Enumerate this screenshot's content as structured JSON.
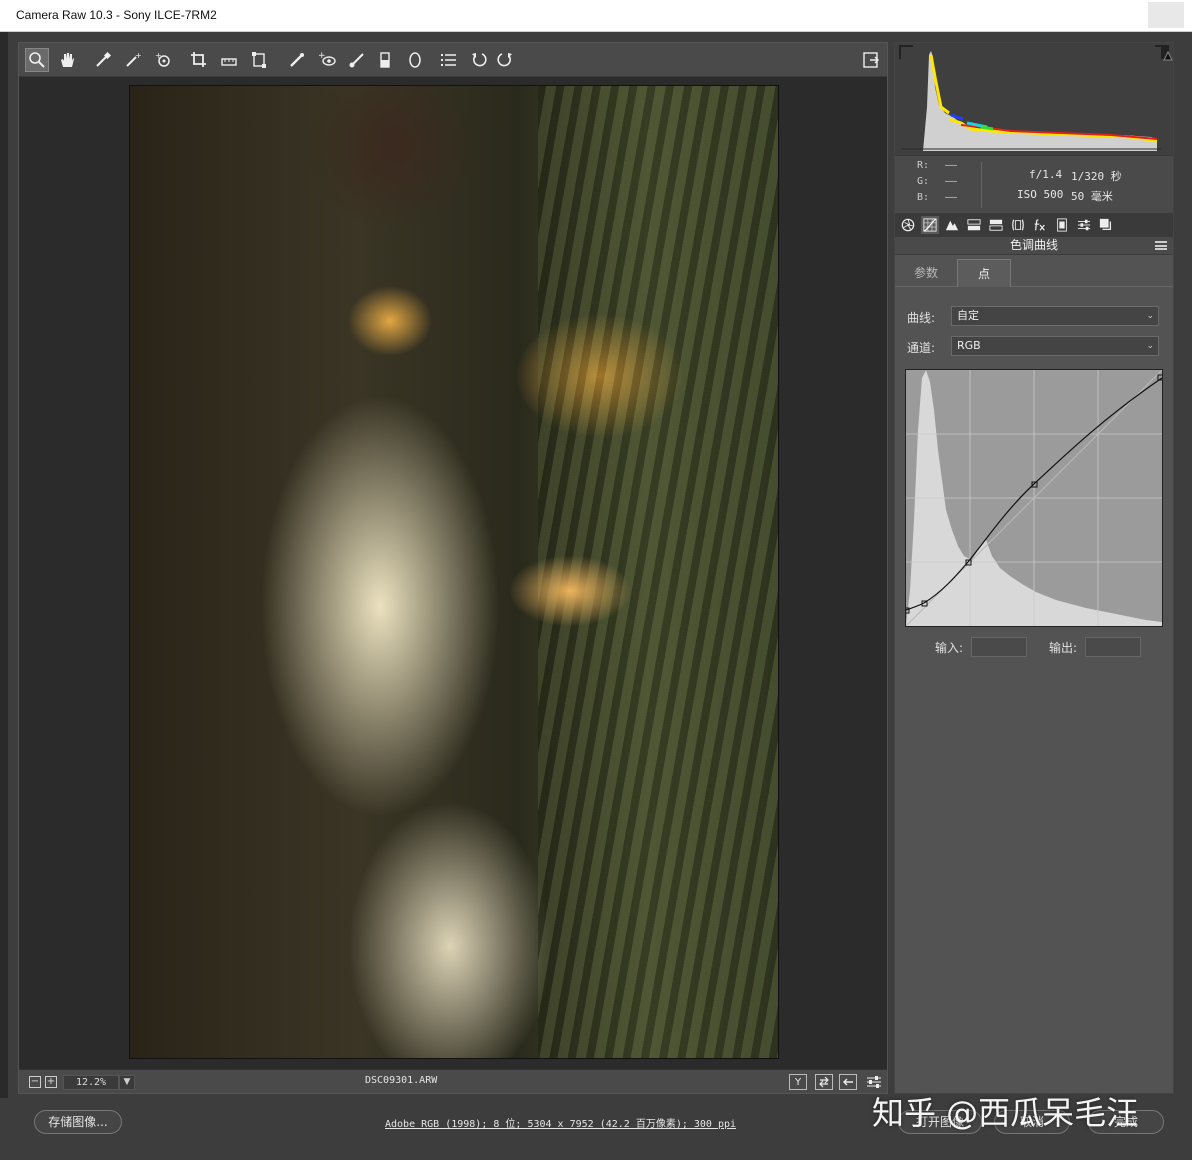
{
  "window": {
    "title": "Camera Raw 10.3 -  Sony ILCE-7RM2"
  },
  "readout": {
    "r_label": "R:",
    "g_label": "G:",
    "b_label": "B:",
    "r_value": "——",
    "g_value": "——",
    "b_value": "——",
    "aperture": "f/1.4",
    "shutter": "1/320 秒",
    "iso": "ISO 500",
    "focal": "50 毫米"
  },
  "panel": {
    "title": "色调曲线",
    "tab_params": "参数",
    "tab_point": "点",
    "curve_label": "曲线:",
    "curve_value": "自定",
    "channel_label": "通道:",
    "channel_value": "RGB",
    "input_label": "输入:",
    "output_label": "输出:"
  },
  "bottom": {
    "zoom": "12.2%",
    "filename": "DSC09301.ARW",
    "y_label": "Y"
  },
  "footer": {
    "save": "存储图像...",
    "workflow": "Adobe RGB (1998); 8 位; 5304 x 7952 (42.2 百万像素); 300 ppi",
    "open": "打开图像",
    "cancel": "取消",
    "done": "完成"
  },
  "watermark": "知乎 @西瓜呆毛汪",
  "icons": [
    "zoom-icon",
    "hand-icon",
    "white-balance-icon",
    "color-sampler-icon",
    "target-adjust-icon",
    "crop-icon",
    "straighten-icon",
    "transform-icon",
    "spot-removal-icon",
    "red-eye-icon",
    "adjustment-brush-icon",
    "graduated-filter-icon",
    "radial-filter-icon",
    "preferences-icon",
    "rotate-left-icon",
    "rotate-right-icon",
    "fullscreen-icon"
  ]
}
